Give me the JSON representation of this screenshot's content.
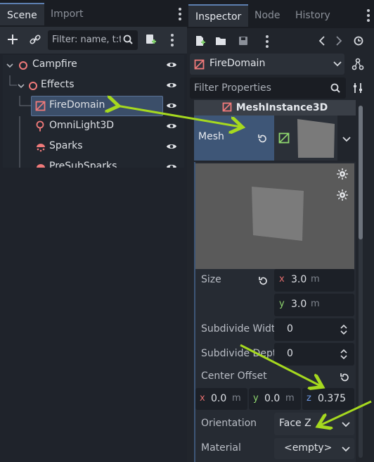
{
  "scene_dock": {
    "tabs": [
      {
        "label": "Scene",
        "active": true
      },
      {
        "label": "Import",
        "active": false
      }
    ],
    "filter_placeholder": "Filter: name, t:t",
    "tree": [
      {
        "label": "Campfire",
        "icon": "node3d-icon",
        "depth": 0,
        "expanded": true
      },
      {
        "label": "Effects",
        "icon": "node3d-icon",
        "depth": 1,
        "expanded": true
      },
      {
        "label": "FireDomain",
        "icon": "mesh-instance-icon",
        "depth": 2,
        "selected": true
      },
      {
        "label": "OmniLight3D",
        "icon": "omni-light-icon",
        "depth": 2
      },
      {
        "label": "Sparks",
        "icon": "particles-icon",
        "depth": 2
      },
      {
        "label": "PreSubSparks",
        "icon": "particles-icon",
        "depth": 2
      }
    ]
  },
  "inspector": {
    "tabs": [
      {
        "label": "Inspector",
        "active": true
      },
      {
        "label": "Node",
        "active": false
      },
      {
        "label": "History",
        "active": false
      }
    ],
    "object_name": "FireDomain",
    "filter_placeholder": "Filter Properties",
    "class_name": "MeshInstance3D",
    "mesh_label": "Mesh",
    "size_label": "Size",
    "size_x": "3.0",
    "size_y": "3.0",
    "size_unit": "m",
    "subdivide_width_label": "Subdivide Widt",
    "subdivide_width": "0",
    "subdivide_depth_label": "Subdivide Dept",
    "subdivide_depth": "0",
    "center_offset_label": "Center Offset",
    "center_offset_x": "0.0",
    "center_offset_y": "0.0",
    "center_offset_z": "0.375",
    "offset_unit": "m",
    "orientation_label": "Orientation",
    "orientation_value": "Face Z",
    "material_label": "Material",
    "material_value": "<empty>"
  },
  "axis_labels": {
    "x": "x",
    "y": "y",
    "z": "z"
  },
  "colors": {
    "accent": "#5d7fb0",
    "selection": "#3b4e69",
    "annotation_arrow": "#a6d91f",
    "node_icon": "#f07a7a",
    "axis_x": "#e06c6c",
    "axis_y": "#8fd66e",
    "axis_z": "#6f9be8"
  }
}
